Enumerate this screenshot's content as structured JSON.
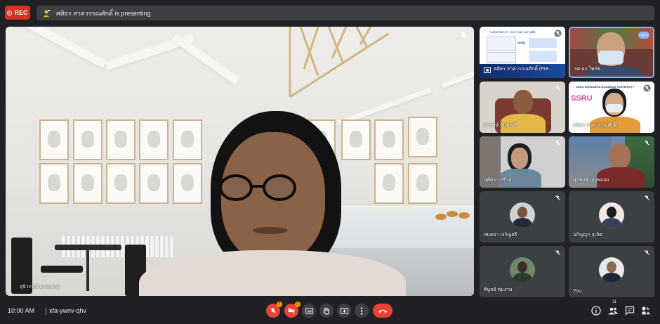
{
  "topbar": {
    "rec_label": "REC",
    "presenting_text": "ศศิธร สาควรรณศักดิ์ is presenting"
  },
  "main_video": {
    "participant_name": "สุจิวรรณ์ ธรรมพาส",
    "mic_muted": true
  },
  "grid": [
    {
      "name": "ศศิธร สาควรรณศักดิ์ (Pre...",
      "type": "presentation",
      "muted": true,
      "slide_title": "ระดับทรัพยากร / ประสานความร่วมมือ"
    },
    {
      "name": "รศ.ดร.ไพรัช...",
      "type": "video",
      "muted": false,
      "active_speaker": true
    },
    {
      "name": "ศิวพงษ์ จันทร์ศรี",
      "type": "video",
      "muted": true
    },
    {
      "name": "ศศิธร สาควรรณศักดิ์",
      "type": "video",
      "muted": true,
      "banner": "SUAN SUNANDHA RAJABHAT UNIVERSITY",
      "logo": "SSRU"
    },
    {
      "name": "สุพัตรา ปรีวล",
      "type": "video",
      "muted": true
    },
    {
      "name": "ศุภพงษ์ บุญพลอย",
      "type": "video",
      "muted": true
    },
    {
      "name": "สมธยา เจริญศรี",
      "type": "avatar",
      "muted": true
    },
    {
      "name": "อภิญญา จุเลิศ",
      "type": "avatar",
      "muted": true
    },
    {
      "name": "พิบูลย์ ทุ่มงาม",
      "type": "avatar",
      "muted": true
    },
    {
      "name": "You",
      "type": "avatar",
      "muted": true
    }
  ],
  "bottombar": {
    "time": "10:00 AM",
    "meeting_code": "xfa-ywnv-qhv",
    "mic_warning": "!",
    "camera_warning": "!",
    "participant_count": "11"
  },
  "colors": {
    "background": "#202124",
    "surface": "#3c4043",
    "danger": "#ea4335",
    "warning": "#f29900",
    "accent": "#8ab4f8"
  }
}
